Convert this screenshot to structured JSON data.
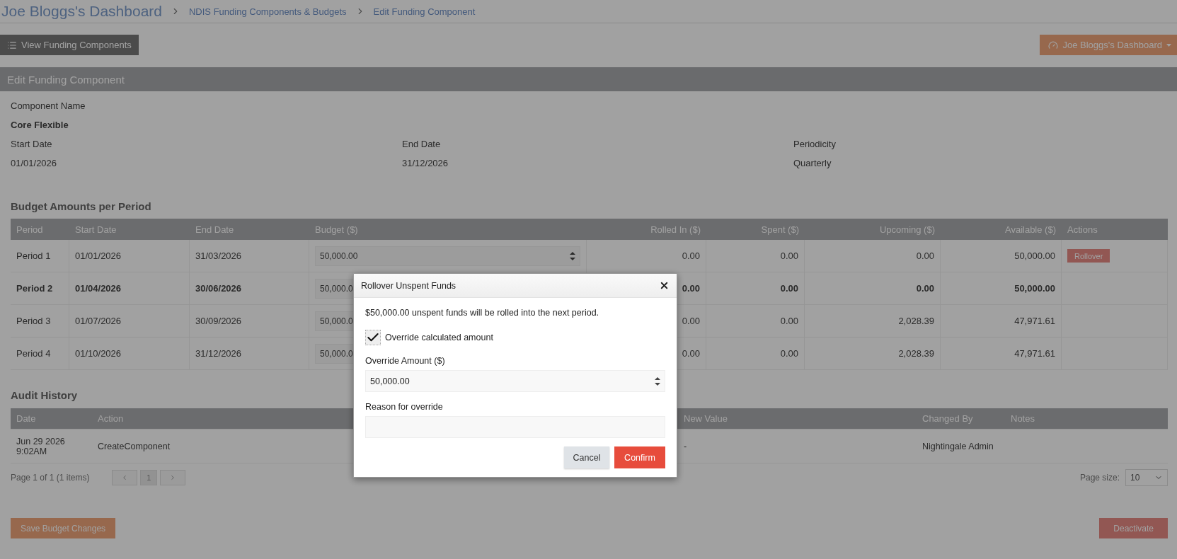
{
  "breadcrumb": {
    "title": "Joe Bloggs's Dashboard",
    "links": [
      "NDIS Funding Components & Budgets",
      "Edit Funding Component"
    ]
  },
  "toolbar": {
    "view_button": "View Funding Components",
    "dashboard_menu": "Joe Bloggs's Dashboard"
  },
  "panel": {
    "title": "Edit Funding Component",
    "component_name": {
      "label": "Component Name",
      "value": "Core Flexible"
    },
    "details": [
      {
        "label": "Start Date",
        "value": "01/01/2026"
      },
      {
        "label": "End Date",
        "value": "31/12/2026"
      },
      {
        "label": "Periodicity",
        "value": "Quarterly"
      }
    ]
  },
  "budget": {
    "title": "Budget Amounts per Period",
    "columns": [
      "Period",
      "Start Date",
      "End Date",
      "Budget ($)",
      "Rolled In ($)",
      "Spent ($)",
      "Upcoming ($)",
      "Available ($)",
      "Actions"
    ],
    "rows": [
      {
        "period": "Period 1",
        "start": "01/01/2026",
        "end": "31/03/2026",
        "budget": "50,000.00",
        "rolled_in": "0.00",
        "spent": "0.00",
        "upcoming": "0.00",
        "available": "50,000.00",
        "current": false,
        "action": "Rollover"
      },
      {
        "period": "Period 2",
        "start": "01/04/2026",
        "end": "30/06/2026",
        "budget": "50,000.0",
        "rolled_in": "0.00",
        "spent": "0.00",
        "upcoming": "0.00",
        "available": "50,000.00",
        "current": true
      },
      {
        "period": "Period 3",
        "start": "01/07/2026",
        "end": "30/09/2026",
        "budget": "50,000.0",
        "rolled_in": "0.00",
        "spent": "0.00",
        "upcoming": "2,028.39",
        "available": "47,971.61",
        "current": false
      },
      {
        "period": "Period 4",
        "start": "01/10/2026",
        "end": "31/12/2026",
        "budget": "50,000.0",
        "rolled_in": "0.00",
        "spent": "0.00",
        "upcoming": "2,028.39",
        "available": "47,971.61",
        "current": false
      }
    ]
  },
  "audit": {
    "title": "Audit History",
    "columns": [
      "Date",
      "Action",
      "New Value",
      "Changed By",
      "Notes"
    ],
    "rows": [
      {
        "cells": [
          "Jun 29 2026 9:02AM",
          "CreateComponent",
          "-",
          "Nightingale Admin"
        ]
      }
    ],
    "pager": {
      "summary": "Page 1 of 1 (1 items)",
      "pages": [
        {
          "label": "1",
          "selected": true
        }
      ],
      "page_size_label": "Page size:",
      "page_size": "10"
    }
  },
  "footer": {
    "save": "Save Budget Changes",
    "deactivate": "Deactivate"
  },
  "modal": {
    "title": "Rollover Unspent Funds",
    "message": "$50,000.00 unspent funds will be rolled into the next period.",
    "override": {
      "label": "Override calculated amount",
      "checked": true
    },
    "amount": {
      "label": "Override Amount ($)",
      "value": "50,000.00"
    },
    "reason": {
      "label": "Reason for override"
    },
    "cancel": "Cancel",
    "confirm": "Confirm"
  }
}
